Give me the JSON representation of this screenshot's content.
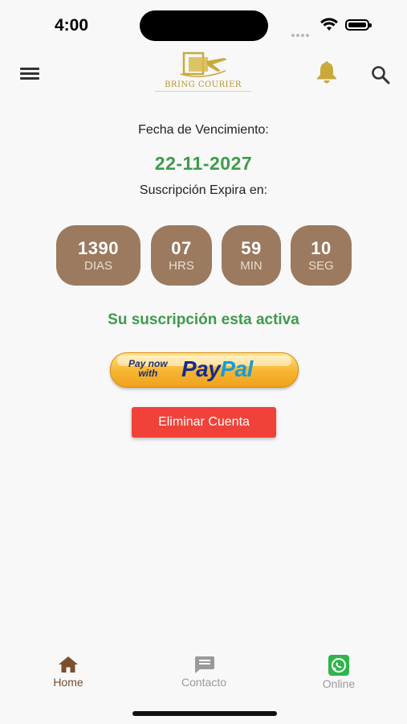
{
  "status_bar": {
    "time": "4:00"
  },
  "header": {
    "logo_text": "BRING COURIER",
    "icons": {
      "menu": "hamburger-menu-icon",
      "bell": "bell-icon",
      "search": "search-icon"
    },
    "accent_gold": "#c9a93a"
  },
  "subscription": {
    "expiration_label": "Fecha de Vencimiento:",
    "expiration_date": "22-11-2027",
    "expires_in_label": "Suscripción Expira en:",
    "countdown": [
      {
        "value": "1390",
        "unit": "DIAS"
      },
      {
        "value": "07",
        "unit": "HRS"
      },
      {
        "value": "59",
        "unit": "MIN"
      },
      {
        "value": "10",
        "unit": "SEG"
      }
    ],
    "status_text": "Su suscripción esta activa",
    "status_color": "#3e9b4a",
    "countdown_color": "#9b7a5f"
  },
  "paypal_button": {
    "line1": "Pay now",
    "line2": "with",
    "brand_pay": "Pay",
    "brand_pal": "Pal"
  },
  "delete_button": {
    "label": "Eliminar Cuenta",
    "color": "#f04238"
  },
  "bottom_nav": {
    "tabs": [
      {
        "label": "Home",
        "icon": "home-icon",
        "active": true,
        "color": "#7b4f2c"
      },
      {
        "label": "Contacto",
        "icon": "chat-bubble-icon",
        "active": false,
        "color": "#9a9a9a"
      },
      {
        "label": "Online",
        "icon": "whatsapp-icon",
        "active": false,
        "color": "#9a9a9a"
      }
    ]
  }
}
